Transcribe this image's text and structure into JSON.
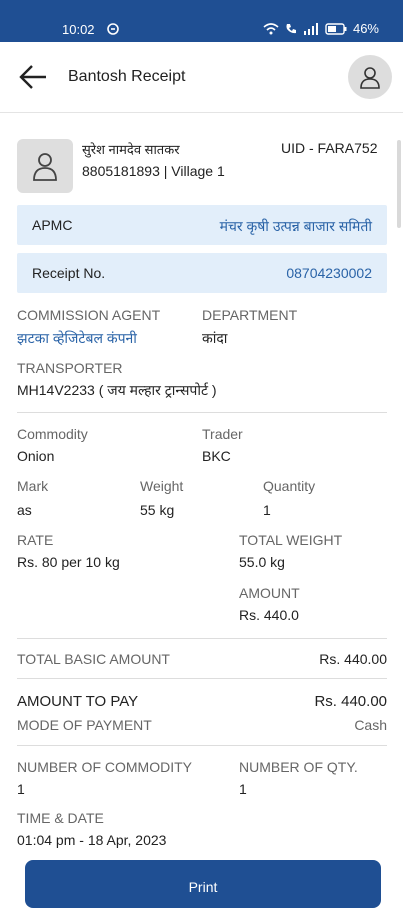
{
  "status": {
    "time": "10:02",
    "battery": "46%"
  },
  "header": {
    "title": "Bantosh Receipt"
  },
  "farmer": {
    "name": "सुरेश नामदेव सातकर",
    "phone_village": "8805181893 | Village 1",
    "uid": "UID - FARA752"
  },
  "apmc": {
    "label": "APMC",
    "value": "मंचर कृषी उत्पन्न बाजार समिती"
  },
  "receipt": {
    "label": "Receipt No.",
    "value": "08704230002"
  },
  "commission_agent": {
    "label": "COMMISSION AGENT",
    "value": "झटका व्हेजिटेबल कंपनी"
  },
  "department": {
    "label": "DEPARTMENT",
    "value": "कांदा"
  },
  "transporter": {
    "label": "TRANSPORTER",
    "value": "MH14V2233 ( जय मल्हार ट्रान्सपोर्ट )"
  },
  "commodity": {
    "label": "Commodity",
    "value": "Onion"
  },
  "trader": {
    "label": "Trader",
    "value": "BKC"
  },
  "mark": {
    "label": "Mark",
    "value": "as"
  },
  "weight": {
    "label": "Weight",
    "value": "55 kg"
  },
  "quantity": {
    "label": "Quantity",
    "value": "1"
  },
  "rate": {
    "label": "RATE",
    "value": "Rs. 80 per 10 kg"
  },
  "total_weight": {
    "label": "TOTAL WEIGHT",
    "value": "55.0 kg"
  },
  "amount": {
    "label": "AMOUNT",
    "value": "Rs. 440.0"
  },
  "total_basic": {
    "label": "TOTAL BASIC AMOUNT",
    "value": "Rs. 440.00"
  },
  "amount_to_pay": {
    "label": "AMOUNT TO PAY",
    "value": "Rs. 440.00"
  },
  "payment_mode": {
    "label": "MODE OF PAYMENT",
    "value": "Cash"
  },
  "num_commodity": {
    "label": "NUMBER OF COMMODITY",
    "value": "1"
  },
  "num_qty": {
    "label": "NUMBER OF QTY.",
    "value": "1"
  },
  "time_date": {
    "label": "TIME & DATE",
    "value": "01:04 pm - 18 Apr, 2023"
  },
  "print_label": "Print",
  "colors": {
    "primary": "#1f4f93",
    "info_bg": "#e2eefa",
    "link": "#2a63a7"
  }
}
